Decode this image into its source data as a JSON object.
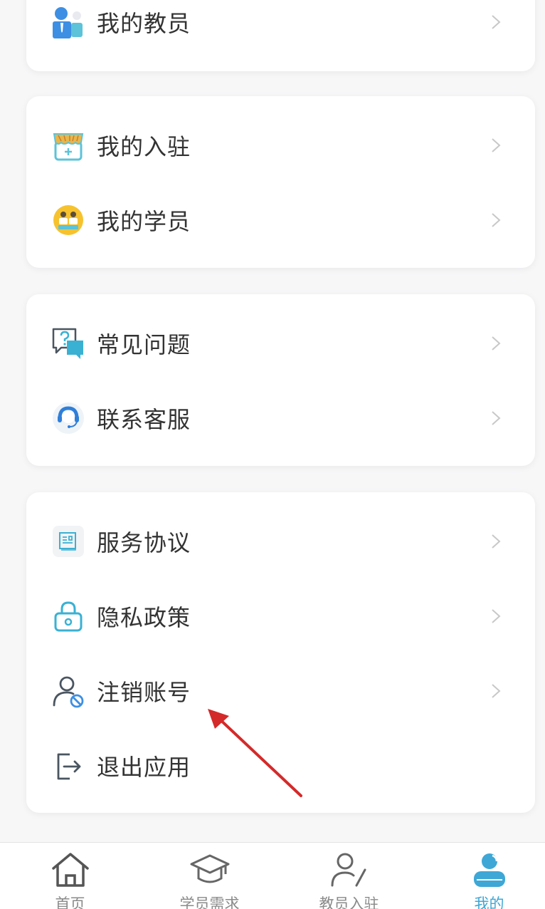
{
  "menu": {
    "card1": {
      "items": [
        {
          "label": "我的教员",
          "icon": "teacher-icon"
        }
      ]
    },
    "card2": {
      "items": [
        {
          "label": "我的入驻",
          "icon": "store-icon"
        },
        {
          "label": "我的学员",
          "icon": "students-icon"
        }
      ]
    },
    "card3": {
      "items": [
        {
          "label": "常见问题",
          "icon": "faq-icon"
        },
        {
          "label": "联系客服",
          "icon": "customer-service-icon"
        }
      ]
    },
    "card4": {
      "items": [
        {
          "label": "服务协议",
          "icon": "document-icon"
        },
        {
          "label": "隐私政策",
          "icon": "lock-icon"
        },
        {
          "label": "注销账号",
          "icon": "cancel-account-icon"
        },
        {
          "label": "退出应用",
          "icon": "logout-icon"
        }
      ]
    }
  },
  "tabbar": {
    "tabs": [
      {
        "label": "首页",
        "icon": "home-icon",
        "active": false
      },
      {
        "label": "学员需求",
        "icon": "graduation-cap-icon",
        "active": false
      },
      {
        "label": "教员入驻",
        "icon": "teacher-register-icon",
        "active": false
      },
      {
        "label": "我的",
        "icon": "profile-icon",
        "active": true
      }
    ]
  },
  "colors": {
    "accent": "#3ea7d6",
    "annotation_arrow": "#d42a2a",
    "text": "#333333",
    "tab_inactive": "#8a8a8a"
  }
}
